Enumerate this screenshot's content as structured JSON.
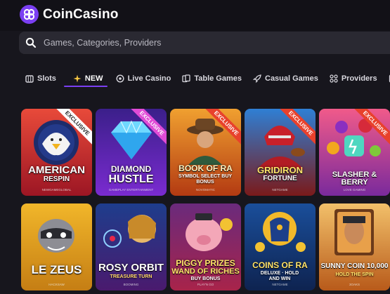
{
  "brand": {
    "name": "CoinCasino",
    "accent": "#7b3ff2"
  },
  "search": {
    "placeholder": "Games, Categories, Providers",
    "icon": "search-icon"
  },
  "nav": {
    "items": [
      {
        "label": "Slots",
        "icon": "slots-icon",
        "active": false
      },
      {
        "label": "NEW",
        "icon": "sparkle-icon",
        "active": true
      },
      {
        "label": "Live Casino",
        "icon": "live-icon",
        "active": false
      },
      {
        "label": "Table Games",
        "icon": "cards-icon",
        "active": false
      },
      {
        "label": "Casual Games",
        "icon": "rocket-icon",
        "active": false
      },
      {
        "label": "Providers",
        "icon": "providers-icon",
        "active": false
      },
      {
        "label": "P",
        "icon": "more-icon",
        "active": false
      }
    ]
  },
  "games": [
    {
      "title_lines": [
        "AMERICAN",
        "RESPIN"
      ],
      "subtitle": "",
      "provider": "NEWGAMEGLOBAL",
      "badge": "EXCLUSIVE"
    },
    {
      "title_lines": [
        "DIAMOND",
        "HUSTLE"
      ],
      "subtitle": "",
      "provider": "GAMEPLAY ENTERTAINMENT",
      "badge": "EXCLUSIVE"
    },
    {
      "title_lines": [
        "BOOK OF RA"
      ],
      "subtitle": "SYMBOL SELECT BUY BONUS",
      "provider": "NOVOMATIC",
      "badge": "EXCLUSIVE"
    },
    {
      "title_lines": [
        "GRIDIRON",
        "FORTUNE"
      ],
      "subtitle": "",
      "provider": "NETGAME",
      "badge": "EXCLUSIVE"
    },
    {
      "title_lines": [
        "SLASHER & BERRY"
      ],
      "subtitle": "",
      "provider": "LOVE GAMING",
      "badge": "EXCLUSIVE"
    },
    {
      "title_lines": [
        "LE ZEUS"
      ],
      "subtitle": "",
      "provider": "HACKSAW",
      "badge": ""
    },
    {
      "title_lines": [
        "ROSY ORBIT"
      ],
      "subtitle": "TREASURE TURN",
      "provider": "BOOMING",
      "badge": ""
    },
    {
      "title_lines": [
        "PIGGY PRIZES",
        "WAND OF RICHES"
      ],
      "subtitle": "BUY BONUS",
      "provider": "PLAY'N GO",
      "badge": ""
    },
    {
      "title_lines": [
        "COINS OF RA"
      ],
      "subtitle": "DELUXE · HOLD AND WIN",
      "provider": "NETGAME",
      "badge": ""
    },
    {
      "title_lines": [
        "SUNNY COIN 10,000"
      ],
      "subtitle": "HOLD THE SPIN",
      "provider": "3OAKS",
      "badge": ""
    }
  ]
}
